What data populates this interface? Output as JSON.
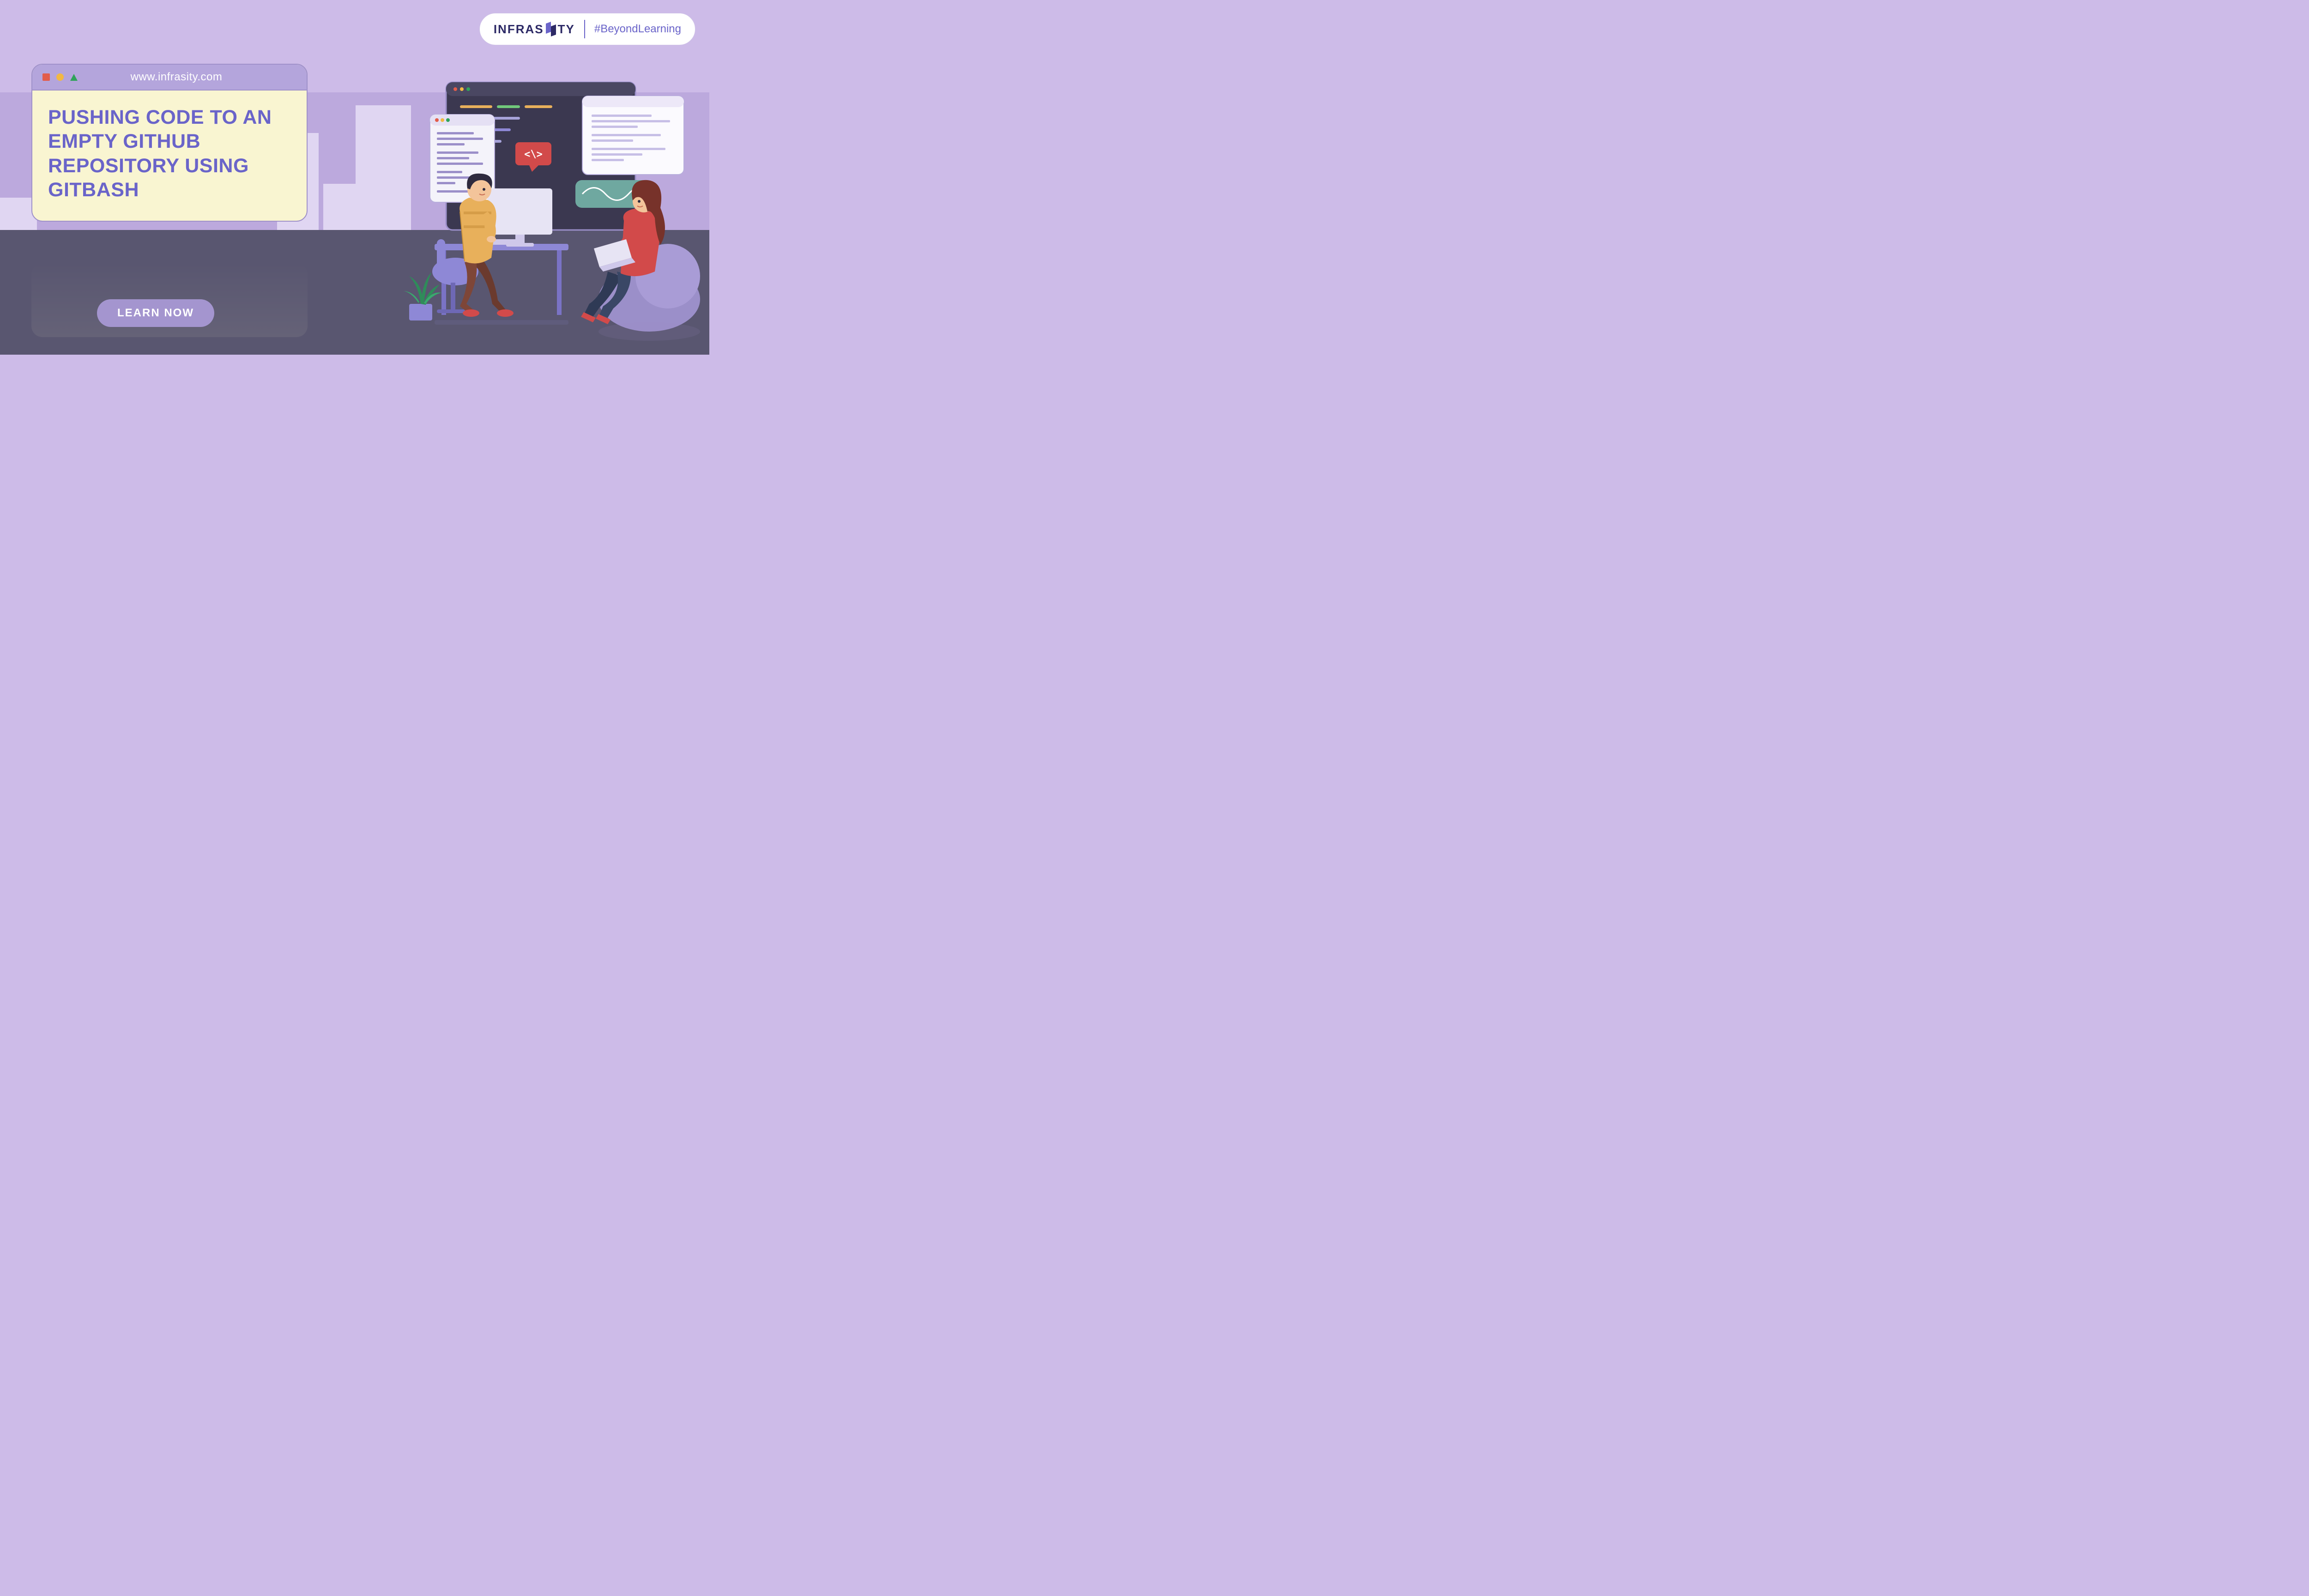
{
  "brand": {
    "name_left": "INFRAS",
    "name_right": "TY",
    "tagline": "#BeyondLearning"
  },
  "card": {
    "url": "www.infrasity.com",
    "headline": "PUSHING CODE TO AN EMPTY GITHUB REPOSITORY USING GITBASH"
  },
  "cta": {
    "label": "LEARN NOW"
  },
  "illustration": {
    "code_tag": "</>",
    "people": "two-developers-at-desk"
  },
  "colors": {
    "bg": "#CDBBE8",
    "accent": "#6A64C9",
    "card_bg": "#F9F5D1",
    "floor": "#595670"
  }
}
